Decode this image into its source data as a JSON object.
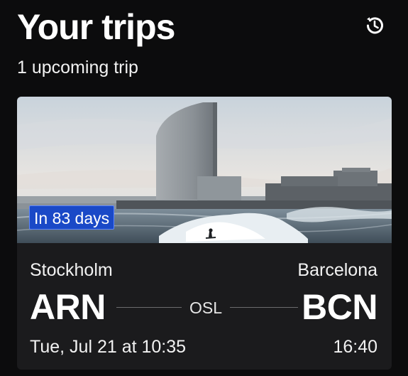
{
  "header": {
    "title": "Your trips",
    "history_icon": "history-icon",
    "subtitle": "1 upcoming trip"
  },
  "trip": {
    "image_description": "beach-hotel-photo",
    "badge": "In 83 days",
    "origin": {
      "city": "Stockholm",
      "code": "ARN",
      "departure": "Tue, Jul 21 at 10:35"
    },
    "stopover": "OSL",
    "destination": {
      "city": "Barcelona",
      "code": "BCN",
      "arrival": "16:40"
    }
  },
  "colors": {
    "background": "#0c0c0d",
    "card": "#1b1b1d",
    "badge": "#1a49c7",
    "text": "#ffffff"
  }
}
